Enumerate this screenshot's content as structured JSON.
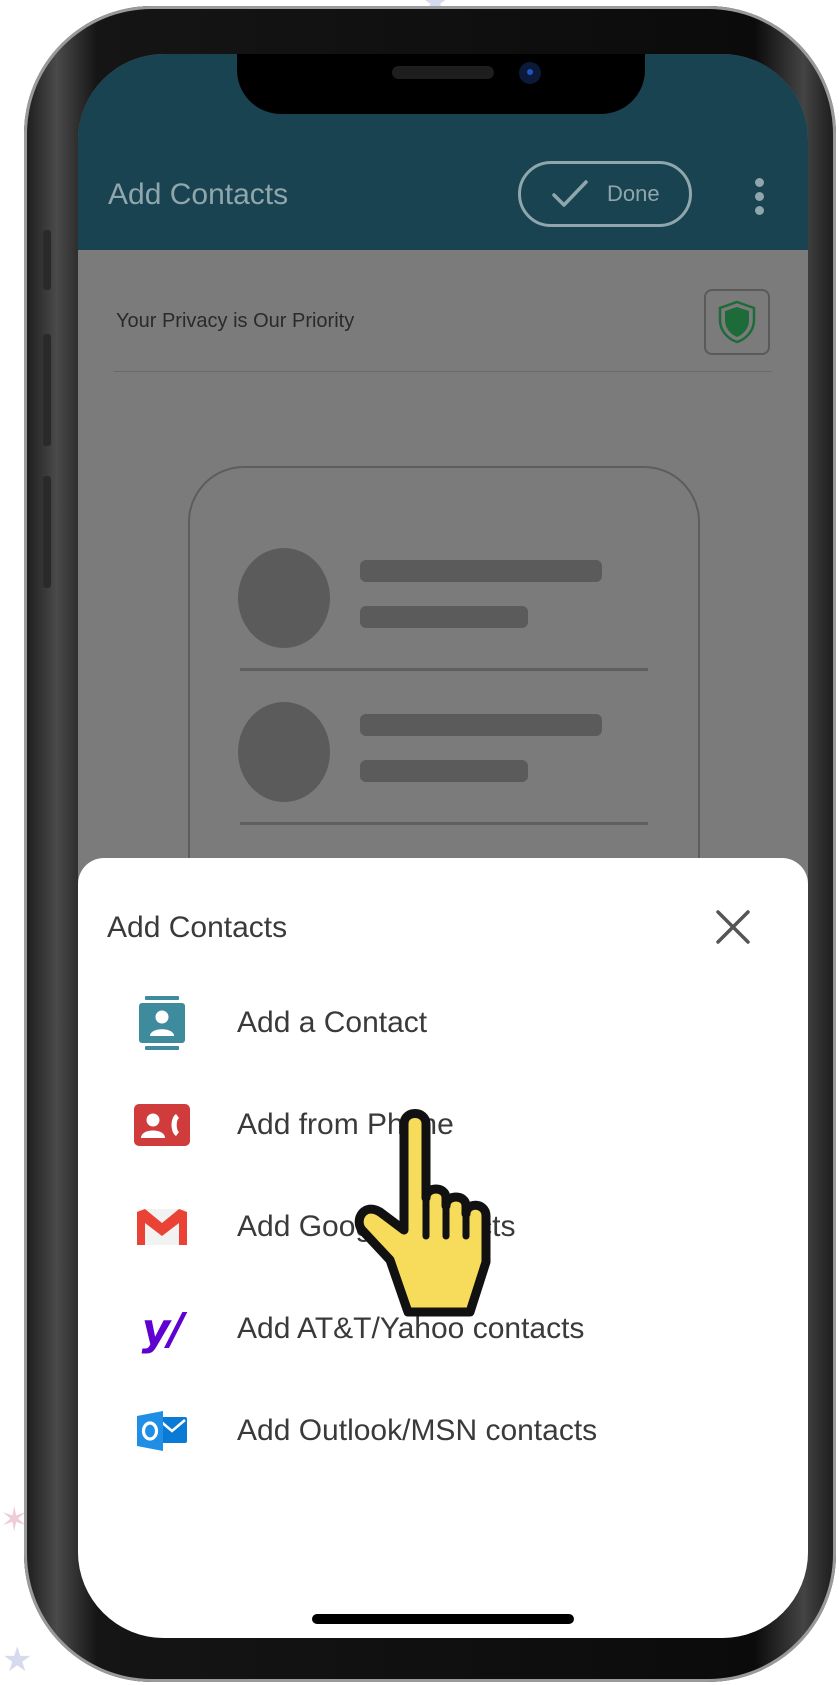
{
  "app_bar": {
    "title": "Add Contacts",
    "done_label": "Done"
  },
  "privacy": {
    "text": "Your Privacy is Our Priority"
  },
  "sheet": {
    "title": "Add Contacts",
    "items": [
      {
        "label": "Add a Contact",
        "icon": "contact-card-icon"
      },
      {
        "label": "Add from Phone",
        "icon": "phone-contacts-icon"
      },
      {
        "label": "Add Google contacts",
        "icon": "gmail-icon"
      },
      {
        "label": "Add AT&T/Yahoo contacts",
        "icon": "yahoo-icon"
      },
      {
        "label": "Add Outlook/MSN contacts",
        "icon": "outlook-icon"
      }
    ]
  },
  "colors": {
    "app_bar": "#1a4351",
    "accent_teal": "#3f8b9e",
    "phone_red": "#d03b3b",
    "gmail_red": "#ea4335",
    "yahoo_purple": "#5f01d1",
    "outlook_blue": "#0a7ad7",
    "shield_green": "#1e6b3a",
    "pointer_yellow": "#f7dc5b"
  }
}
